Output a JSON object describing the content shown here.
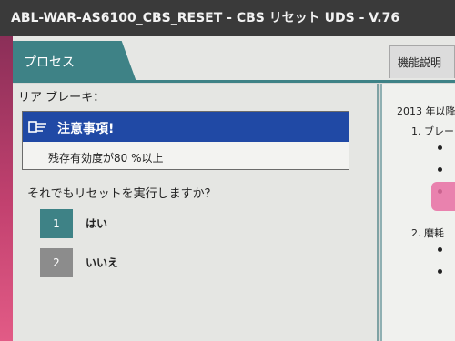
{
  "window": {
    "title": "ABL-WAR-AS6100_CBS_RESET - CBS リセット UDS - V.76"
  },
  "tabs": {
    "process": "プロセス",
    "function_description": "機能説明"
  },
  "main": {
    "section_title": "リア ブレーキ：",
    "notice": {
      "title": "注意事項!",
      "body": "残存有効度が80 %以上",
      "icon": "hand-pointer-icon"
    },
    "question": "それでもリセットを実行しますか？",
    "options": [
      {
        "number": "1",
        "label": "はい"
      },
      {
        "number": "2",
        "label": "いいえ"
      }
    ]
  },
  "description_panel": {
    "line1": "2013 年以降",
    "item1": "1.  ブレー",
    "item2": "2.  磨耗",
    "bullet_count_item1": 3,
    "bullet_count_item2": 2
  },
  "colors": {
    "teal": "#3e8286",
    "notice_blue": "#2049a5",
    "title_bar": "#3a3a3a"
  }
}
